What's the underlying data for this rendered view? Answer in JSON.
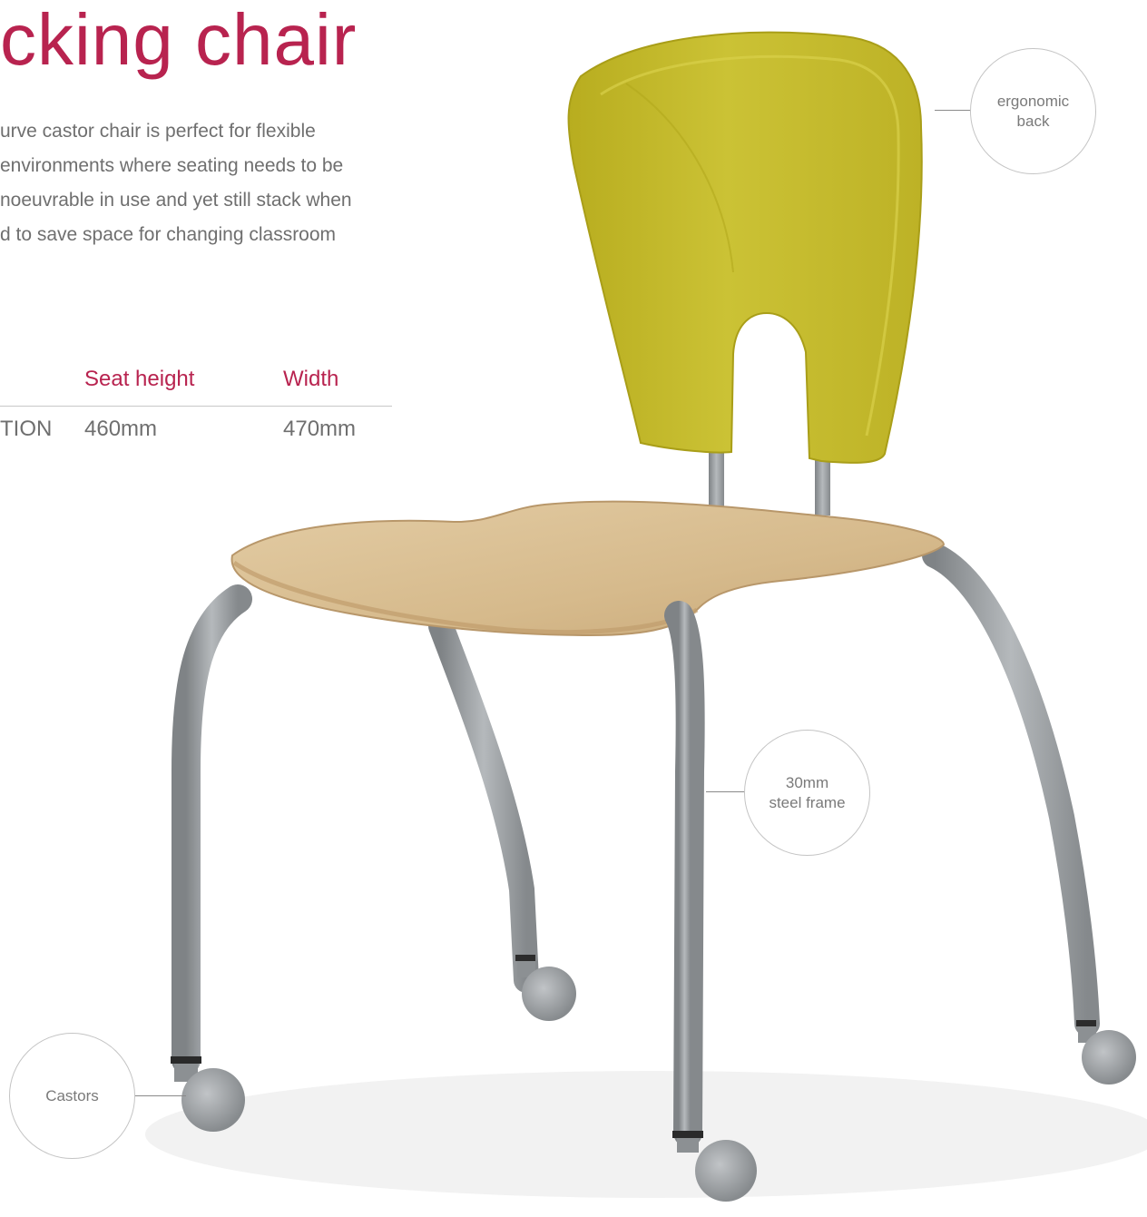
{
  "heading": {
    "title": "cking chair"
  },
  "description": {
    "lines": [
      "urve castor chair is perfect for flexible",
      "environments where seating needs to be",
      "noeuvrable in use and yet still stack when",
      "d to save space for changing classroom"
    ]
  },
  "specs": {
    "headers": [
      "Seat height",
      "Width"
    ],
    "row": {
      "label": "TION",
      "seat_height": "460mm",
      "width": "470mm"
    }
  },
  "callouts": {
    "back": [
      "ergonomic",
      "back"
    ],
    "frame": [
      "30mm",
      "steel frame"
    ],
    "castors": "Castors"
  },
  "colors": {
    "accent": "#b8234f",
    "shell": "#c6bd2d",
    "seat": "#d8be92",
    "frame": "#9ea2a5",
    "castor": "#a8acaf"
  }
}
